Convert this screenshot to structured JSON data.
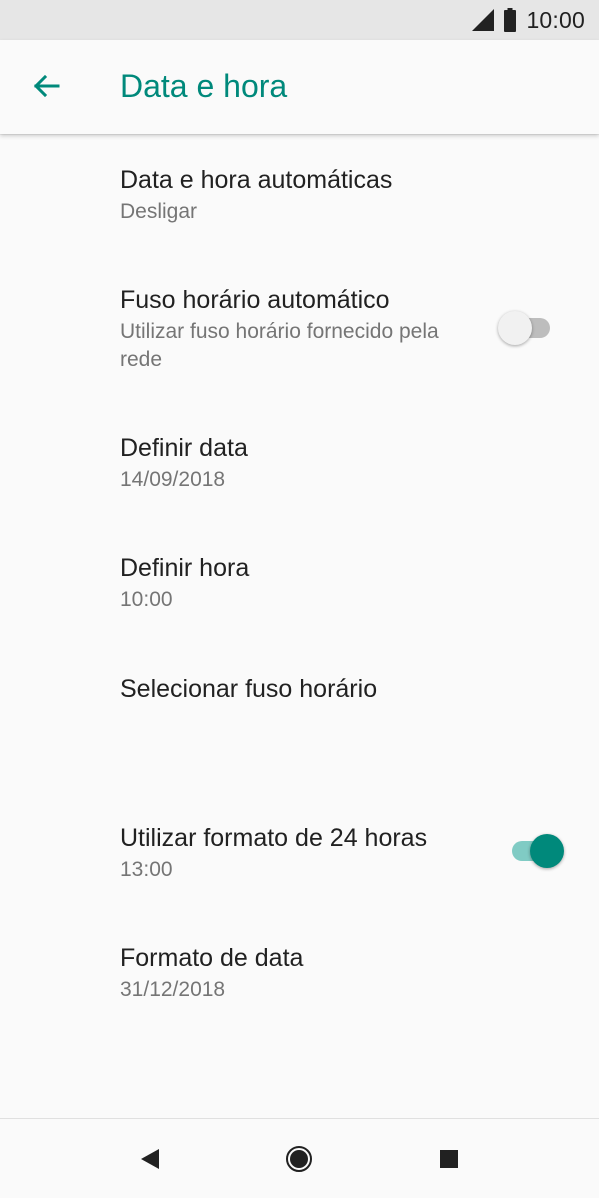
{
  "status_bar": {
    "time": "10:00"
  },
  "app_bar": {
    "title": "Data e hora"
  },
  "settings": {
    "auto_datetime": {
      "title": "Data e hora automáticas",
      "summary": "Desligar"
    },
    "auto_timezone": {
      "title": "Fuso horário automático",
      "summary": "Utilizar fuso horário fornecido pela rede",
      "enabled": false
    },
    "set_date": {
      "title": "Definir data",
      "summary": "14/09/2018"
    },
    "set_time": {
      "title": "Definir hora",
      "summary": "10:00"
    },
    "select_timezone": {
      "title": "Selecionar fuso horário"
    },
    "use_24h": {
      "title": "Utilizar formato de 24 horas",
      "summary": "13:00",
      "enabled": true
    },
    "date_format": {
      "title": "Formato de data",
      "summary": "31/12/2018"
    }
  },
  "colors": {
    "accent": "#00897b",
    "accent_track": "#80cbc4",
    "text_primary": "#212121",
    "text_secondary": "#757575"
  },
  "icons": {
    "back": "arrow-left-icon",
    "signal": "cellular-signal-icon",
    "battery": "battery-icon",
    "nav_back": "triangle-back-icon",
    "nav_home": "circle-home-icon",
    "nav_recents": "square-recents-icon"
  }
}
